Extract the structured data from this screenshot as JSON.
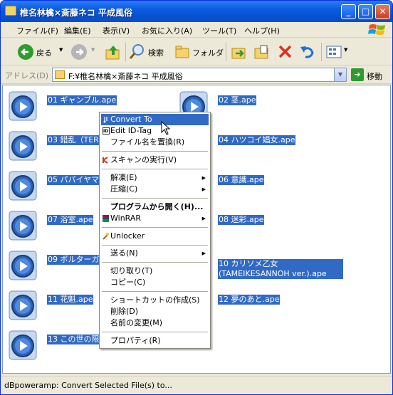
{
  "window": {
    "title": "椎名林檎×斎藤ネコ 平成風俗"
  },
  "menubar": {
    "items": [
      "ファイル(F)",
      "編集(E)",
      "表示(V)",
      "お気に入り(A)",
      "ツール(T)",
      "ヘルプ(H)"
    ]
  },
  "toolbar": {
    "back": "戻る",
    "search": "検索",
    "folders": "フォルダ"
  },
  "address": {
    "label": "アドレス(D)",
    "path": "F:¥椎名林檎×斎藤ネコ 平成風俗",
    "go": "移動"
  },
  "files": [
    "01 ギャンブル.ape",
    "02 茎.ape",
    "03 錯乱（TERF",
    "04 ハツコイ娼女.ape",
    "05 パパイヤマン",
    "06 意識.ape",
    "07 浴室.ape",
    "08 迷彩.ape",
    "09 ポルターガイ",
    "10 カリソメ乙女 (TAMEIKESANNOH ver.).ape",
    "11 花魁.ape",
    "12 夢のあと.ape",
    "13 この世の限り"
  ],
  "context_menu": {
    "convert": "Convert To",
    "edit_id": "Edit ID-Tag",
    "rename_files": "ファイル名を置換(R)",
    "scan": "スキャンの実行(V)",
    "extract": "解凍(E)",
    "compress": "圧縮(C)",
    "open_with": "プログラムから開く(H)...",
    "winrar": "WinRAR",
    "unlocker": "Unlocker",
    "send_to": "送る(N)",
    "cut": "切り取り(T)",
    "copy": "コピー(C)",
    "shortcut": "ショートカットの作成(S)",
    "delete": "削除(D)",
    "rename": "名前の変更(M)",
    "properties": "プロパティ(R)"
  },
  "status": {
    "text": "dBpoweramp: Convert Selected File(s) to..."
  },
  "colors": {
    "selection": "#316ac5",
    "title_bar": "#0a5ce0",
    "window_bg": "#ece9d8"
  }
}
